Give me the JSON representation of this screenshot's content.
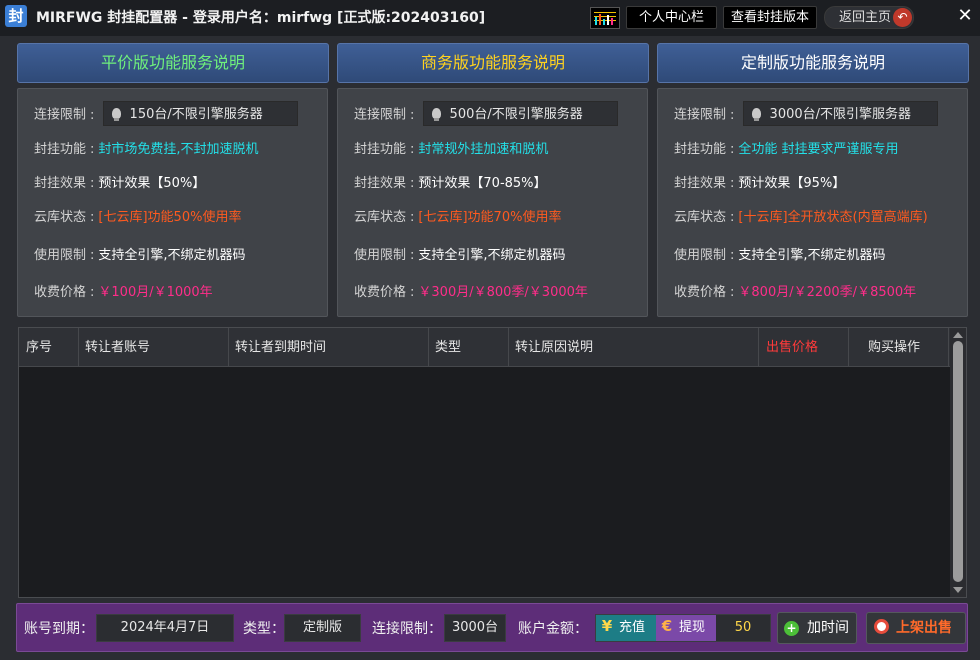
{
  "window": {
    "icon_text": "封",
    "title": "MIRFWG 封挂配置器 - 登录用户名：mirfwg  [正式版:202403160]",
    "buttons": {
      "personal": "个人中心栏",
      "view_version": "查看封挂版本",
      "home": "返回主页"
    },
    "close": "✕"
  },
  "plans": [
    {
      "title": "平价版功能服务说明",
      "title_color": "#6ff07c",
      "rows": [
        {
          "label": "连接限制",
          "value": "150台/不限引擎服务器"
        },
        {
          "label": "封挂功能",
          "value": "封市场免费挂,不封加速脱机"
        },
        {
          "label": "封挂效果",
          "value": "预计效果【50%】"
        },
        {
          "label": "云库状态",
          "value": "[七云库]功能50%使用率"
        },
        {
          "label": "使用限制",
          "value": "支持全引擎,不绑定机器码"
        },
        {
          "label": "收费价格",
          "value": "￥100月/￥1000年"
        }
      ]
    },
    {
      "title": "商务版功能服务说明",
      "title_color": "#ffd21f",
      "rows": [
        {
          "label": "连接限制",
          "value": "500台/不限引擎服务器"
        },
        {
          "label": "封挂功能",
          "value": "封常规外挂加速和脱机"
        },
        {
          "label": "封挂效果",
          "value": "预计效果【70-85%】"
        },
        {
          "label": "云库状态",
          "value": "[七云库]功能70%使用率"
        },
        {
          "label": "使用限制",
          "value": "支持全引擎,不绑定机器码"
        },
        {
          "label": "收费价格",
          "value": "￥300月/￥800季/￥3000年"
        }
      ]
    },
    {
      "title": "定制版功能服务说明",
      "title_color": "#ffffff",
      "rows": [
        {
          "label": "连接限制",
          "value": "3000台/不限引擎服务器"
        },
        {
          "label": "封挂功能",
          "value": "全功能 封挂要求严谨服专用"
        },
        {
          "label": "封挂效果",
          "value": "预计效果【95%】"
        },
        {
          "label": "云库状态",
          "value": "[十云库]全开放状态(内置高端库)"
        },
        {
          "label": "使用限制",
          "value": "支持全引擎,不绑定机器码"
        },
        {
          "label": "收费价格",
          "value": "￥800月/￥2200季/￥8500年"
        }
      ]
    }
  ],
  "table": {
    "headers": [
      "序号",
      "转让者账号",
      "转让者到期时间",
      "类型",
      "转让原因说明",
      "出售价格",
      "购买操作"
    ],
    "rows": []
  },
  "bottom": {
    "expire_label": "账号到期：",
    "expire_value": "2024年4月7日",
    "type_label": "类型：",
    "type_value": "定制版",
    "limit_label": "连接限制：",
    "limit_value": "3000台",
    "balance_label": "账户金额：",
    "recharge": "充值",
    "withdraw": "提现",
    "amount": "50",
    "add_time": "加时间",
    "list_sale": "上架出售"
  },
  "colors": {
    "cyan": "#23e0e8",
    "orange": "#ff5a1f",
    "pink": "#ff2d8a",
    "price_header": "#ff3a3a",
    "bottom_bar": "#5d2d78"
  }
}
